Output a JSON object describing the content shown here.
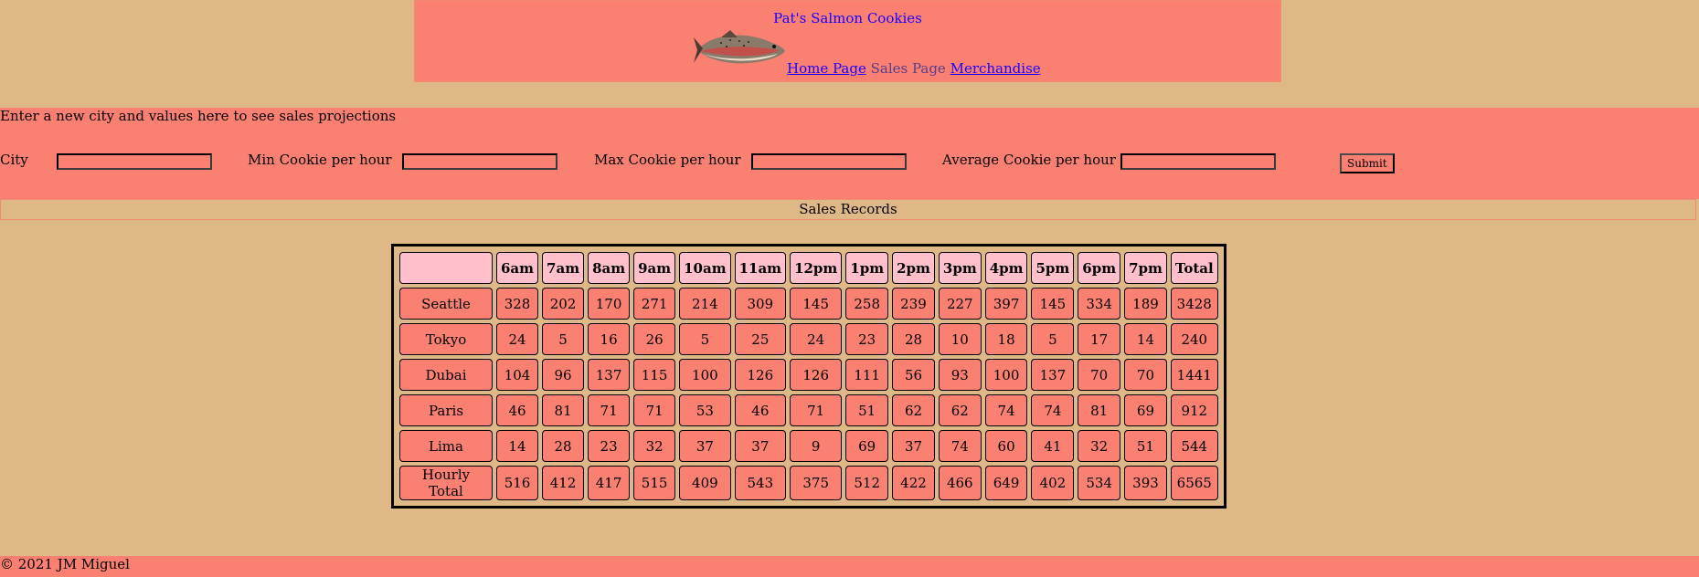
{
  "header": {
    "title": "Pat's Salmon Cookies",
    "nav": [
      {
        "label": "Home Page",
        "current": false
      },
      {
        "label": "Sales Page",
        "current": true
      },
      {
        "label": "Merchandise",
        "current": false
      }
    ]
  },
  "form": {
    "intro": "Enter a new city and values here to see sales projections",
    "city_label": "City",
    "min_label": "Min Cookie per hour",
    "max_label": "Max Cookie per hour",
    "avg_label": "Average Cookie per hour",
    "submit_label": "Submit"
  },
  "records_heading": "Sales Records",
  "table": {
    "headers": [
      "",
      "6am",
      "7am",
      "8am",
      "9am",
      "10am",
      "11am",
      "12pm",
      "1pm",
      "2pm",
      "3pm",
      "4pm",
      "5pm",
      "6pm",
      "7pm",
      "Total"
    ],
    "rows": [
      {
        "city": "Seattle",
        "values": [
          "328",
          "202",
          "170",
          "271",
          "214",
          "309",
          "145",
          "258",
          "239",
          "227",
          "397",
          "145",
          "334",
          "189",
          "3428"
        ]
      },
      {
        "city": "Tokyo",
        "values": [
          "24",
          "5",
          "16",
          "26",
          "5",
          "25",
          "24",
          "23",
          "28",
          "10",
          "18",
          "5",
          "17",
          "14",
          "240"
        ]
      },
      {
        "city": "Dubai",
        "values": [
          "104",
          "96",
          "137",
          "115",
          "100",
          "126",
          "126",
          "111",
          "56",
          "93",
          "100",
          "137",
          "70",
          "70",
          "1441"
        ]
      },
      {
        "city": "Paris",
        "values": [
          "46",
          "81",
          "71",
          "71",
          "53",
          "46",
          "71",
          "51",
          "62",
          "62",
          "74",
          "74",
          "81",
          "69",
          "912"
        ]
      },
      {
        "city": "Lima",
        "values": [
          "14",
          "28",
          "23",
          "32",
          "37",
          "37",
          "9",
          "69",
          "37",
          "74",
          "60",
          "41",
          "32",
          "51",
          "544"
        ]
      }
    ],
    "footer": {
      "label": "Hourly Total",
      "values": [
        "516",
        "412",
        "417",
        "515",
        "409",
        "543",
        "375",
        "512",
        "422",
        "466",
        "649",
        "402",
        "534",
        "393",
        "6565"
      ]
    }
  },
  "footer": {
    "copyright": "© 2021 JM Miguel"
  },
  "colors": {
    "background": "#deb887",
    "salmon": "#fa8072",
    "header_cell": "#ffc0cb",
    "link": "#1a00ff"
  }
}
